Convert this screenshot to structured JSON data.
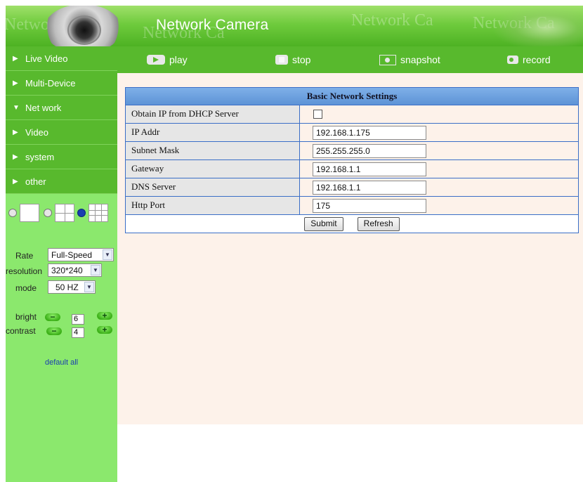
{
  "header": {
    "title": "Network Camera",
    "watermark": [
      "Network Ca",
      "Network Ca",
      "Network Ca",
      "Network Ca"
    ]
  },
  "toolbar": {
    "play": "play",
    "stop": "stop",
    "snapshot": "snapshot",
    "record": "record"
  },
  "sidebar": {
    "items": [
      {
        "label": "Live Video",
        "arrow": "▶"
      },
      {
        "label": "Multi-Device",
        "arrow": "▶"
      },
      {
        "label": "Net work",
        "arrow": "▼"
      },
      {
        "label": "Video",
        "arrow": "▶"
      },
      {
        "label": "system",
        "arrow": "▶"
      },
      {
        "label": "other",
        "arrow": "▶"
      }
    ],
    "view_layout_selected": "9-grid"
  },
  "controls": {
    "rate_label": "Rate",
    "rate_value": "Full-Speed",
    "resolution_label": "resolution",
    "resolution_value": "320*240",
    "mode_label": "mode",
    "mode_value": "50 HZ",
    "bright_label": "bright",
    "bright_value": "6",
    "contrast_label": "contrast",
    "contrast_value": "4",
    "default_all": "default all",
    "minus": "−",
    "plus": "+"
  },
  "network_settings": {
    "title": "Basic Network Settings",
    "dhcp_label": "Obtain IP from DHCP Server",
    "dhcp_checked": false,
    "ip_label": "IP Addr",
    "ip_value": "192.168.1.175",
    "mask_label": "Subnet Mask",
    "mask_value": "255.255.255.0",
    "gateway_label": "Gateway",
    "gateway_value": "192.168.1.1",
    "dns_label": "DNS Server",
    "dns_value": "192.168.1.1",
    "port_label": "Http Port",
    "port_value": "175",
    "submit": "Submit",
    "refresh": "Refresh"
  },
  "colors": {
    "nav_green": "#58b92d",
    "sidebar_green": "#8be86d",
    "header_blue": "#5d93d6",
    "content_bg": "#fdf2ea"
  }
}
